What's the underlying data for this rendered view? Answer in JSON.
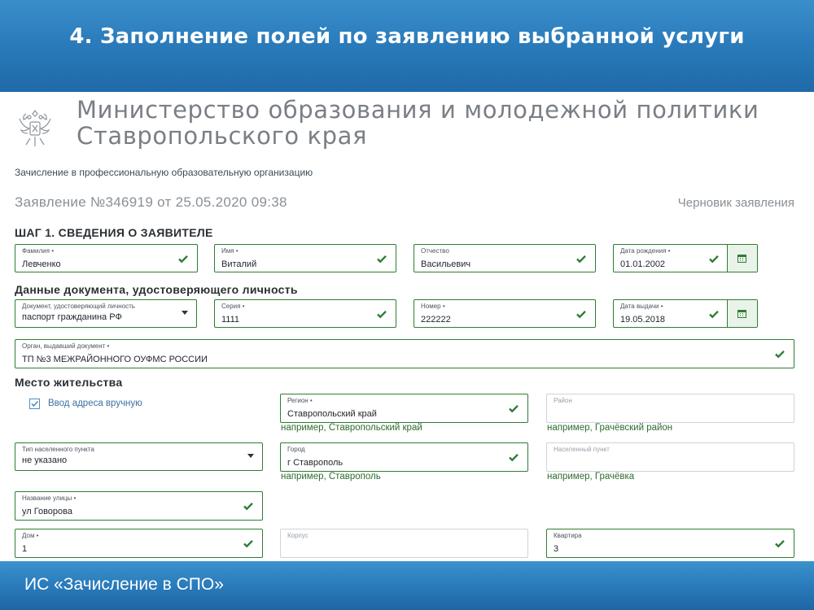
{
  "slide": {
    "title": "4. Заполнение полей по заявлению выбранной услуги",
    "footer": "ИС «Зачисление в СПО»"
  },
  "header": {
    "ministry_line1": "Министерство образования и молодежной политики",
    "ministry_line2": "Ставропольского края"
  },
  "service_name": "Зачисление в профессиональную образовательную организацию",
  "application": {
    "number": "Заявление №346919 от 25.05.2020 09:38",
    "status": "Черновик заявления"
  },
  "step1": {
    "title": "ШАГ 1. СВЕДЕНИЯ О ЗАЯВИТЕЛЕ",
    "surname": {
      "label": "Фамилия •",
      "value": "Левченко"
    },
    "name": {
      "label": "Имя •",
      "value": "Виталий"
    },
    "patronymic": {
      "label": "Отчество",
      "value": "Васильевич"
    },
    "birth_date": {
      "label": "Дата рождения •",
      "value": "01.01.2002"
    }
  },
  "identity": {
    "title": "Данные документа, удостоверяющего личность",
    "doc_type": {
      "label": "Документ, удостоверяющий личность",
      "value": "паспорт гражданина РФ"
    },
    "series": {
      "label": "Серия •",
      "value": "1111"
    },
    "number": {
      "label": "Номер •",
      "value": "222222"
    },
    "issue_date": {
      "label": "Дата выдачи •",
      "value": "19.05.2018"
    },
    "issuer": {
      "label": "Орган, выдавший документ •",
      "value": "ТП №3 МЕЖРАЙОННОГО ОУФМС РОССИИ"
    }
  },
  "residence": {
    "title": "Место жительства",
    "manual_address": "Ввод адреса вручную",
    "region": {
      "label": "Регион •",
      "value": "Ставропольский край",
      "hint": "например, Ставропольский край"
    },
    "district": {
      "label": "Район",
      "value": "",
      "hint": "например, Грачёвский район"
    },
    "locality_type": {
      "label": "Тип населенного пункта",
      "value": "не указано"
    },
    "city": {
      "label": "Город",
      "value": "г Ставрополь",
      "hint": "например, Ставрополь"
    },
    "locality": {
      "label": "Населенный пункт",
      "value": "",
      "hint": "например, Грачёвка"
    },
    "street": {
      "label": "Название улицы •",
      "value": "ул Говорова"
    },
    "house": {
      "label": "Дом •",
      "value": "1"
    },
    "building": {
      "label": "Корпус",
      "value": ""
    },
    "apartment": {
      "label": "Квартира",
      "value": "3"
    }
  },
  "colors": {
    "accent_green": "#2e7d32",
    "header_blue": "#2b7cbc",
    "checkbox_blue": "#4a90c8"
  }
}
